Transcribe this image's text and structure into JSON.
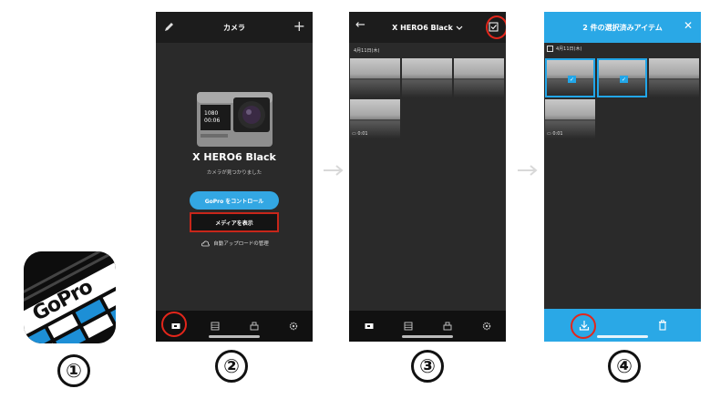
{
  "steps": [
    "①",
    "②",
    "③",
    "④"
  ],
  "app_icon": {
    "text": "GoPro"
  },
  "screen2": {
    "title": "カメラ",
    "camera_name": "X HERO6 Black",
    "camera_found": "カメラが見つかりました",
    "control_button": "GoPro をコントロール",
    "media_button": "メディアを表示",
    "auto_upload": "自動アップロードの管理"
  },
  "screen3": {
    "title": "X HERO6 Black",
    "date": "4月11日(木)",
    "video_duration": "0:01"
  },
  "screen4": {
    "title": "2 件の選択済みアイテム",
    "date": "4月11日(木)",
    "video_duration": "0:01"
  },
  "colors": {
    "accent_blue": "#33a7e3",
    "highlight_red": "#e3261b",
    "select_blue": "#22a6e8"
  }
}
